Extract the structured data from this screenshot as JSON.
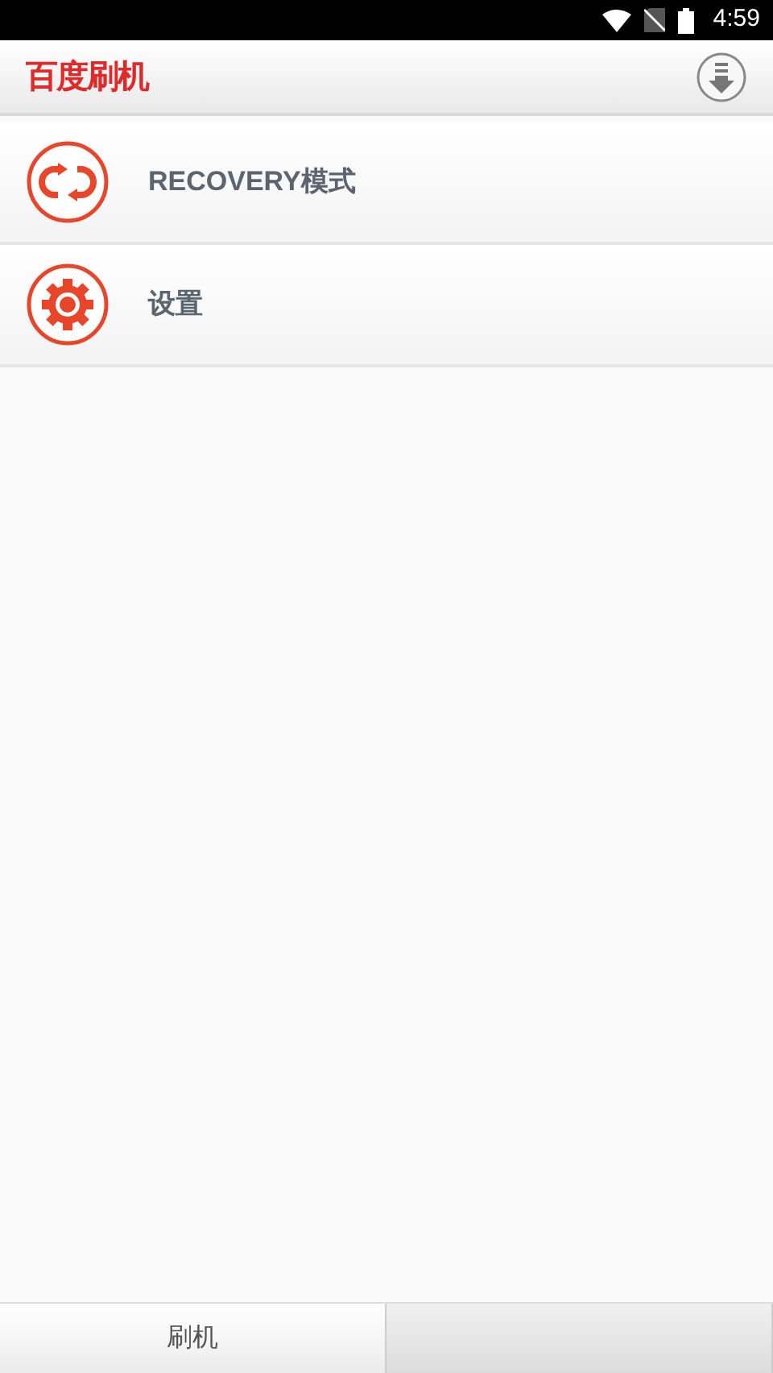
{
  "status_bar": {
    "time": "4:59"
  },
  "header": {
    "title": "百度刷机"
  },
  "menu": [
    {
      "kind": "recovery",
      "label": "RECOVERY模式"
    },
    {
      "kind": "settings",
      "label": "设置"
    }
  ],
  "tabs": [
    {
      "label": "刷机",
      "selected": true
    },
    {
      "selected": false
    }
  ]
}
